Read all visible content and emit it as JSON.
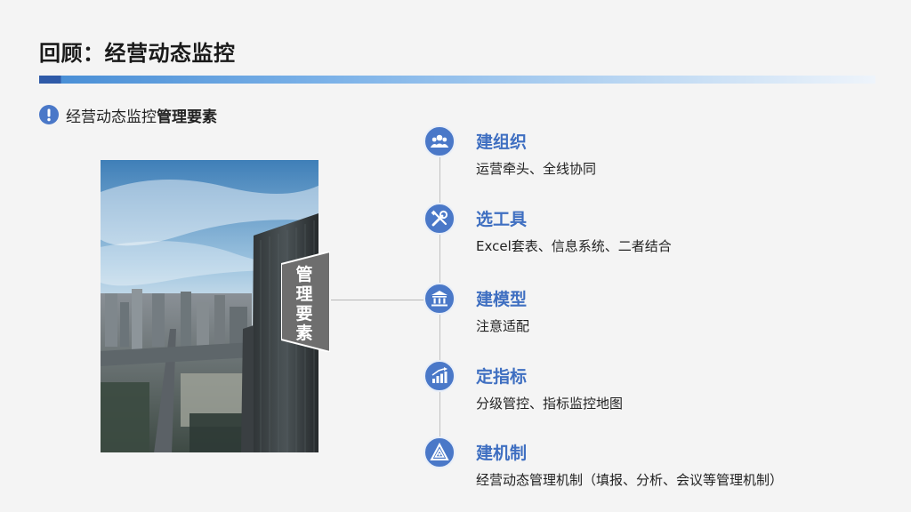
{
  "header": {
    "title": "回顾：经营动态监控"
  },
  "subtitle": {
    "prefix": "经营动态监控",
    "emphasis": "管理要素"
  },
  "side_tag": {
    "chars": [
      "管",
      "理",
      "要",
      "素"
    ]
  },
  "items": [
    {
      "icon": "team-icon",
      "title": "建组织",
      "desc": "运营牵头、全线协同"
    },
    {
      "icon": "tools-icon",
      "title": "选工具",
      "desc": "Excel套表、信息系统、二者结合"
    },
    {
      "icon": "institution-icon",
      "title": "建模型",
      "desc": "注意适配"
    },
    {
      "icon": "growth-chart-icon",
      "title": "定指标",
      "desc": "分级管控、指标监控地图"
    },
    {
      "icon": "triangle-logo-icon",
      "title": "建机制",
      "desc": "经营动态管理机制（填报、分析、会议等管理机制）"
    }
  ],
  "colors": {
    "accent": "#3f6fc1",
    "icon_bg": "#4a78c8",
    "tag_bg": "#6e6e6e"
  }
}
